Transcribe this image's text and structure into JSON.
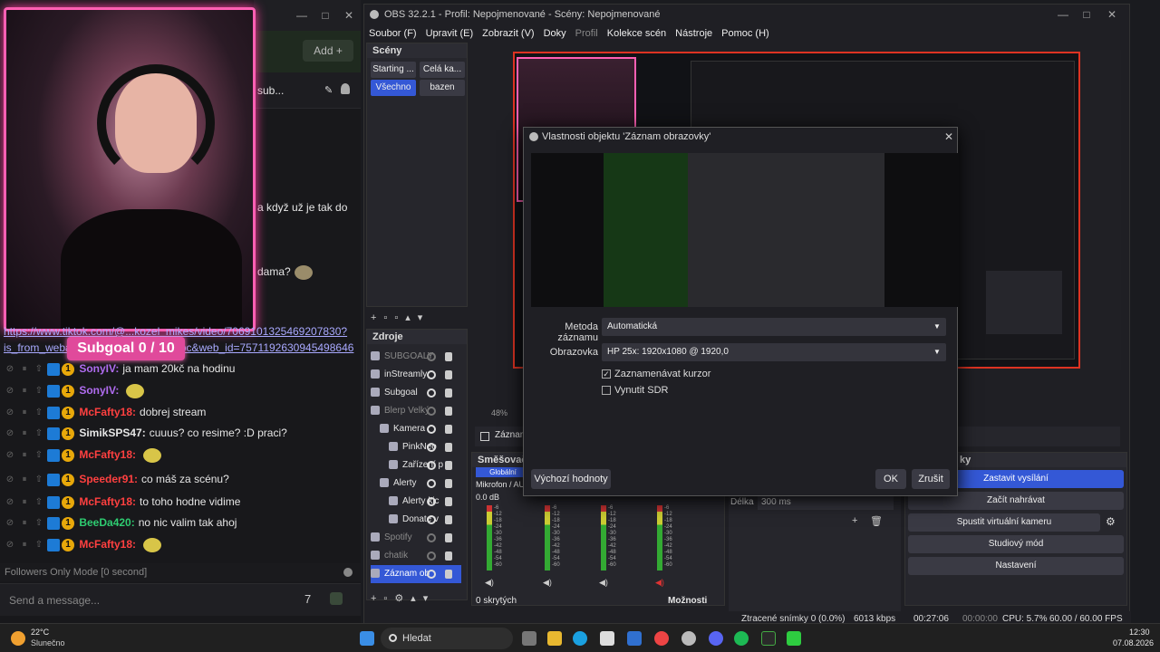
{
  "chat": {
    "add_label": "Add +",
    "header_text": "sub...",
    "partial_lines": [
      "a když už je tak do",
      "dama?"
    ],
    "link_lines": [
      "https://www.tiktok.com/@...kozel_mikes/video/7069101325469207830?",
      "is_from_webapp=1&sender_device=pc&web_id=7571192630945498646"
    ],
    "subgoal": "Subgoal  0 / 10",
    "messages": [
      {
        "user": "SonyIV:",
        "text": "ja mam 20kč na hodinu",
        "color": "#b06cf0"
      },
      {
        "user": "SonyIV:",
        "text": "",
        "color": "#b06cf0"
      },
      {
        "user": "McFafty18:",
        "text": "dobrej stream",
        "color": "#ff4040"
      },
      {
        "user": "SimikSPS47:",
        "text": "cuuus? co resime? :D praci?",
        "color": "#e6e6e6"
      },
      {
        "user": "McFafty18:",
        "text": "",
        "color": "#ff4040"
      },
      {
        "user": "Speeder91:",
        "text": "co máš za scénu?",
        "color": "#ff4040"
      },
      {
        "user": "McFafty18:",
        "text": "to toho hodne vidime",
        "color": "#ff4040"
      },
      {
        "user": "BeeDa420:",
        "text": "no nic valim tak ahoj",
        "color": "#2ecc71"
      },
      {
        "user": "McFafty18:",
        "text": "",
        "color": "#ff4040"
      }
    ],
    "followers_mode": "Followers Only Mode [0 second]",
    "input_placeholder": "Send a message..."
  },
  "obs": {
    "title": "OBS 32.2.1 - Profil: Nepojmenované - Scény: Nepojmenované",
    "menu": [
      "Soubor (F)",
      "Upravit (E)",
      "Zobrazit (V)",
      "Doky",
      "Profil",
      "Kolekce scén",
      "Nástroje",
      "Pomoc (H)"
    ],
    "scenes_title": "Scény",
    "scenes": [
      "Starting ...",
      "Celá ka...",
      "Všechno",
      "bazen"
    ],
    "sources_title": "Zdroje",
    "sources": [
      {
        "name": "SUBGOALY",
        "dim": true,
        "indent": 0
      },
      {
        "name": "inStreamly",
        "dim": false,
        "indent": 0
      },
      {
        "name": "Subgoal",
        "dim": false,
        "indent": 0
      },
      {
        "name": "Blerp Velký",
        "dim": true,
        "indent": 0
      },
      {
        "name": "Kamera",
        "dim": false,
        "indent": 1
      },
      {
        "name": "PinkNeo",
        "dim": false,
        "indent": 2
      },
      {
        "name": "Zařízení p",
        "dim": false,
        "indent": 2
      },
      {
        "name": "Alerty",
        "dim": false,
        "indent": 1
      },
      {
        "name": "Alerty kic",
        "dim": false,
        "indent": 2
      },
      {
        "name": "Donate v",
        "dim": false,
        "indent": 2
      },
      {
        "name": "Spotify",
        "dim": true,
        "indent": 0
      },
      {
        "name": "chatik",
        "dim": true,
        "indent": 0
      },
      {
        "name": "Záznam ob",
        "dim": false,
        "indent": 0,
        "selected": true
      }
    ],
    "zoom": "48%",
    "source_label": "Záznam",
    "mixer_title": "Směšovač zvuku",
    "mixer_global": "Globální",
    "mixer_channel": "Mikrofon / AUX",
    "mixer_db": "0.0 dB",
    "meter_ticks": [
      "-6",
      "-12",
      "-18",
      "-24",
      "-30",
      "-36",
      "-42",
      "-48",
      "-54",
      "-60"
    ],
    "hidden_count": "0 skrytých",
    "options_label": "Možnosti",
    "transition_length_label": "Délka",
    "transition_length": "300 ms",
    "controls": [
      "Zastavit vysílání",
      "Začít nahrávat",
      "Spustit virtuální kameru",
      "Studiový mód",
      "Nastavení"
    ],
    "controls_title": "ky",
    "status": {
      "dropped": "Ztracené snímky 0 (0.0%)",
      "bitrate": "6013 kbps",
      "stream_time": "00:27:06",
      "rec_time": "00:00:00",
      "cpu": "CPU: 5.7%",
      "fps": "60.00 / 60.00 FPS"
    }
  },
  "dialog": {
    "title": "Vlastnosti objektu 'Záznam obrazovky'",
    "method_label": "Metoda záznamu",
    "method_value": "Automatická",
    "display_label": "Obrazovka",
    "display_value": "HP 25x: 1920x1080 @ 1920,0",
    "capture_cursor": "Zaznamenávat kurzor",
    "force_sdr": "Vynutit SDR",
    "defaults_button": "Výchozí hodnoty",
    "ok_button": "OK",
    "cancel_button": "Zrušit"
  },
  "taskbar": {
    "weather_temp": "22°C",
    "weather_desc": "Slunečno",
    "search_label": "Hledat",
    "time": "12:30",
    "date": "07.08.2026"
  }
}
